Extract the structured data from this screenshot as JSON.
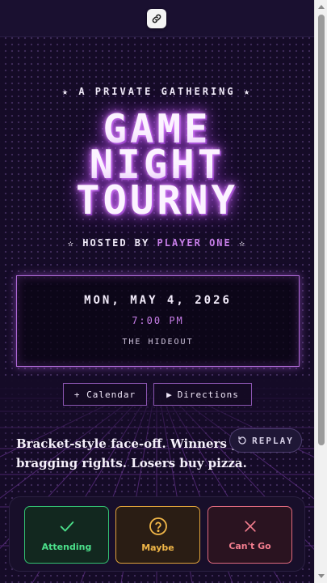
{
  "colors": {
    "accent": "#c77ee8",
    "background": "#150b27",
    "attending": "#4be08a",
    "maybe": "#f0b648",
    "cant_go": "#f27d8e"
  },
  "header": {
    "link_icon": "link-icon"
  },
  "event": {
    "kicker_star": "★",
    "kicker_text": "A PRIVATE GATHERING",
    "title_lines": [
      "GAME",
      "NIGHT",
      "TOURNY"
    ],
    "host_label": "HOSTED BY",
    "host_name": "PLAYER ONE",
    "host_star": "✫",
    "date": "MON, MAY 4, 2026",
    "time": "7:00 PM",
    "place": "THE HIDEOUT",
    "calendar_label": "+ Calendar",
    "directions_icon": "▶",
    "directions_label": "Directions",
    "description": "Bracket-style face-off. Winners get bragging rights. Losers buy pizza."
  },
  "replay": {
    "label": "REPLAY",
    "icon": "replay-icon"
  },
  "rsvp": {
    "attending": "Attending",
    "maybe": "Maybe",
    "cant_go": "Can't Go"
  }
}
